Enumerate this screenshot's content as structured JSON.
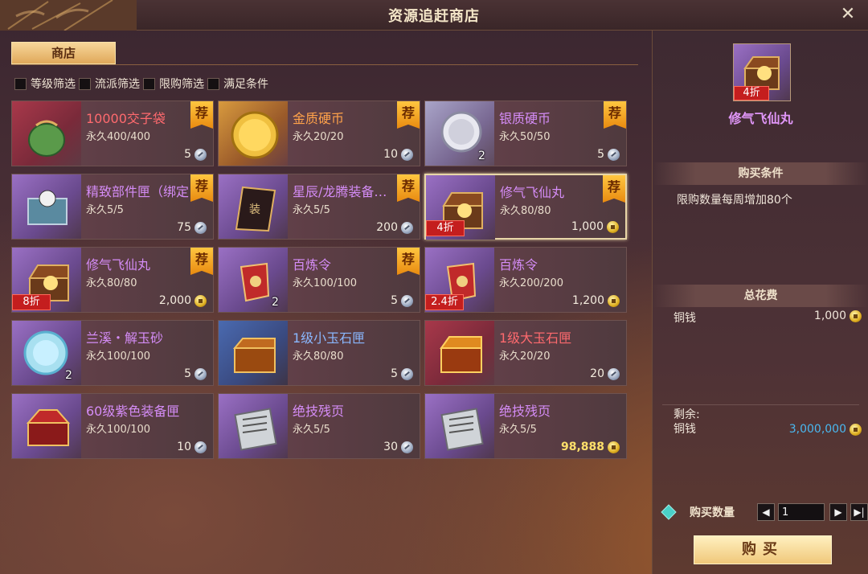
{
  "window": {
    "title": "资源追赶商店",
    "close_icon": "close-icon"
  },
  "tabs": [
    {
      "label": "商店",
      "active": true
    }
  ],
  "filters": [
    "等级筛选",
    "流派筛选",
    "限购筛选",
    "满足条件"
  ],
  "items": [
    {
      "name": "10000交子袋",
      "stock": "永久400/400",
      "price": "5",
      "currency": "silver",
      "recommended": true,
      "rarity": "red",
      "icon": "money-bag-icon"
    },
    {
      "name": "金质硬币",
      "stock": "永久20/20",
      "price": "10",
      "currency": "silver",
      "recommended": true,
      "rarity": "orange",
      "icon": "gold-coin-icon"
    },
    {
      "name": "银质硬币",
      "stock": "永久50/50",
      "price": "5",
      "currency": "silver",
      "recommended": true,
      "rarity": "purple",
      "icon": "silver-coin-icon",
      "qty": "2"
    },
    {
      "name": "精致部件匣（绑定",
      "stock": "永久5/5",
      "price": "75",
      "currency": "silver",
      "recommended": true,
      "rarity": "purple",
      "icon": "parts-box-icon"
    },
    {
      "name": "星辰/龙腾装备…",
      "stock": "永久5/5",
      "price": "200",
      "currency": "silver",
      "recommended": true,
      "rarity": "purple",
      "icon": "equipment-scroll-icon"
    },
    {
      "name": "修气飞仙丸",
      "stock": "永久80/80",
      "price": "1,000",
      "currency": "gold",
      "recommended": true,
      "rarity": "purple",
      "icon": "treasure-chest-icon",
      "discount": "4折",
      "selected": true
    },
    {
      "name": "修气飞仙丸",
      "stock": "永久80/80",
      "price": "2,000",
      "currency": "gold",
      "recommended": true,
      "rarity": "purple",
      "icon": "treasure-chest-icon",
      "discount": "8折"
    },
    {
      "name": "百炼令",
      "stock": "永久100/100",
      "price": "5",
      "currency": "silver",
      "recommended": true,
      "rarity": "purple",
      "icon": "token-icon",
      "qty": "2"
    },
    {
      "name": "百炼令",
      "stock": "永久200/200",
      "price": "1,200",
      "currency": "gold",
      "recommended": false,
      "rarity": "purple",
      "icon": "token-icon",
      "discount": "2.4折"
    },
    {
      "name": "兰溪・解玉砂",
      "stock": "永久100/100",
      "price": "5",
      "currency": "silver",
      "recommended": false,
      "rarity": "purple",
      "icon": "jade-sand-icon",
      "qty": "2"
    },
    {
      "name": "1级小玉石匣",
      "stock": "永久80/80",
      "price": "5",
      "currency": "silver",
      "recommended": false,
      "rarity": "blue",
      "icon": "small-jade-box-icon"
    },
    {
      "name": "1级大玉石匣",
      "stock": "永久20/20",
      "price": "20",
      "currency": "silver",
      "recommended": false,
      "rarity": "red",
      "icon": "large-jade-box-icon"
    },
    {
      "name": "60级紫色装备匣",
      "stock": "永久100/100",
      "price": "10",
      "currency": "silver",
      "recommended": false,
      "rarity": "purple",
      "icon": "equipment-box-icon"
    },
    {
      "name": "绝技残页",
      "stock": "永久5/5",
      "price": "30",
      "currency": "silver",
      "recommended": false,
      "rarity": "purple",
      "icon": "skill-page-icon"
    },
    {
      "name": "绝技残页",
      "stock": "永久5/5",
      "price": "98,888",
      "currency": "gold",
      "recommended": false,
      "rarity": "purple",
      "icon": "skill-page-icon",
      "price_highlight": true
    }
  ],
  "badges": {
    "recommended": "荐"
  },
  "detail": {
    "name": "修气飞仙丸",
    "discount": "4折",
    "condition_title": "购买条件",
    "condition": "限购数量每周增加80个",
    "cost_title": "总花费",
    "cost_label": "铜钱",
    "cost_value": "1,000",
    "remain_label": "剩余:",
    "remain_currency": "铜钱",
    "remain_value": "3,000,000",
    "qty_label": "购买数量",
    "qty_value": "1",
    "buy_label": "购买"
  },
  "colors": {
    "accent": "#f0c87a",
    "discount": "#c41e1e",
    "remain": "#4ab8f0"
  }
}
